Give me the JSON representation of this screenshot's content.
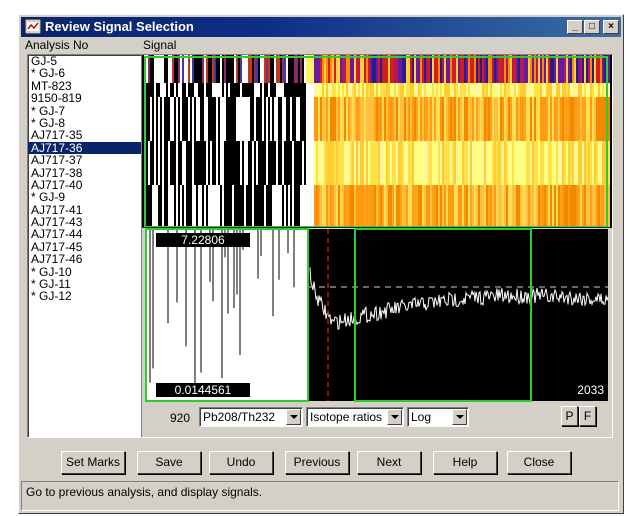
{
  "window": {
    "title": "Review Signal Selection",
    "controls": {
      "minimize": "_",
      "maximize": "□",
      "close": "×"
    }
  },
  "labels": {
    "analysis_no": "Analysis No",
    "signal": "Signal"
  },
  "analyses": [
    "GJ-5",
    "* GJ-6",
    "MT-823",
    "9150-819",
    "* GJ-7",
    "* GJ-8",
    "AJ717-35",
    "AJ717-36",
    "AJ717-37",
    "AJ717-38",
    "AJ717-40",
    "* GJ-9",
    "AJ717-41",
    "AJ717-43",
    "AJ717-44",
    "AJ717-45",
    "AJ717-46",
    "* GJ-10",
    "* GJ-11",
    "* GJ-12"
  ],
  "selected_analysis": "AJ717-36",
  "plot": {
    "max_label": "7.22806",
    "min_label": "0.0144561",
    "count_label": "2033",
    "colors": {
      "background": "#000000",
      "marker": "#00cc00",
      "threshold": "#cc0000"
    }
  },
  "controls": {
    "channel_value": "920",
    "ratio_select": "Pb208/Th232",
    "mode_select": "Isotope ratios",
    "scale_select": "Log",
    "p_button": "P",
    "f_button": "F"
  },
  "buttons": {
    "set_marks": "Set Marks",
    "save": "Save",
    "undo": "Undo",
    "previous": "Previous",
    "next": "Next",
    "help": "Help",
    "close": "Close"
  },
  "status_text": "Go to previous analysis, and display signals."
}
